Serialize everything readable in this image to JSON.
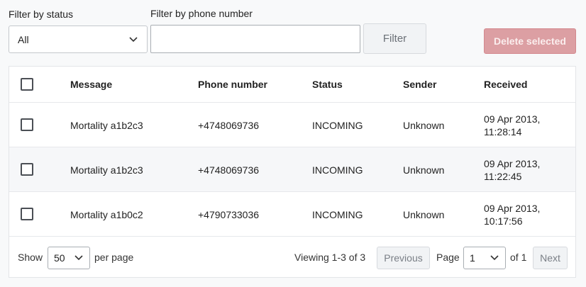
{
  "filters": {
    "status_label": "Filter by status",
    "status_value": "All",
    "phone_label": "Filter by phone number",
    "phone_value": "",
    "filter_button": "Filter"
  },
  "actions": {
    "delete_selected": "Delete selected"
  },
  "table": {
    "headers": [
      "Message",
      "Phone number",
      "Status",
      "Sender",
      "Received"
    ],
    "rows": [
      {
        "message": "Mortality a1b2c3",
        "phone": "+4748069736",
        "status": "INCOMING",
        "sender": "Unknown",
        "received_date": "09 Apr 2013,",
        "received_time": "11:28:14"
      },
      {
        "message": "Mortality a1b2c3",
        "phone": "+4748069736",
        "status": "INCOMING",
        "sender": "Unknown",
        "received_date": "09 Apr 2013,",
        "received_time": "11:22:45"
      },
      {
        "message": "Mortality a1b0c2",
        "phone": "+4790733036",
        "status": "INCOMING",
        "sender": "Unknown",
        "received_date": "09 Apr 2013,",
        "received_time": "10:17:56"
      }
    ]
  },
  "pagination": {
    "show_label": "Show",
    "per_page_value": "50",
    "per_page_label": "per page",
    "viewing": "Viewing 1-3 of 3",
    "previous": "Previous",
    "page_label": "Page",
    "page_value": "1",
    "of_label": "of 1",
    "next": "Next"
  },
  "icons": {
    "dropdown": "chevron-down-icon",
    "checkbox": "checkbox-icon"
  }
}
